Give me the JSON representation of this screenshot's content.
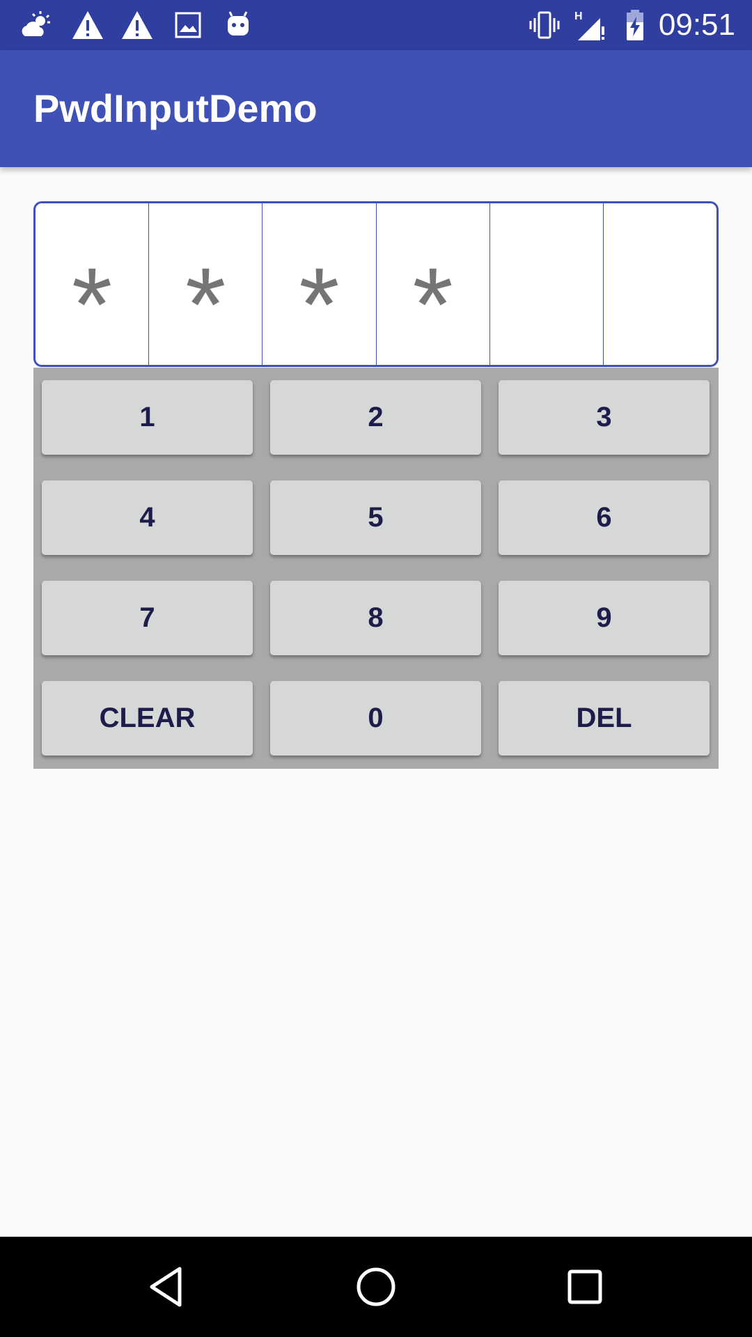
{
  "status_bar": {
    "left_icons": [
      "weather-partly-cloudy-icon",
      "warning-icon",
      "warning-icon",
      "image-icon",
      "android-icon"
    ],
    "right_icons": [
      "vibrate-icon",
      "signal-h-icon",
      "battery-charging-icon"
    ],
    "time": "09:51"
  },
  "app_bar": {
    "title": "PwdInputDemo",
    "color": "#3F51B5",
    "status_color": "#303F9F"
  },
  "password": {
    "length": 6,
    "cells": [
      "*",
      "*",
      "*",
      "*",
      "",
      ""
    ]
  },
  "keypad": {
    "keys": [
      {
        "label": "1"
      },
      {
        "label": "2"
      },
      {
        "label": "3"
      },
      {
        "label": "4"
      },
      {
        "label": "5"
      },
      {
        "label": "6"
      },
      {
        "label": "7"
      },
      {
        "label": "8"
      },
      {
        "label": "9"
      },
      {
        "label": "CLEAR"
      },
      {
        "label": "0"
      },
      {
        "label": "DEL"
      }
    ]
  },
  "nav_bar": {
    "buttons": [
      "back-icon",
      "home-icon",
      "recents-icon"
    ]
  }
}
